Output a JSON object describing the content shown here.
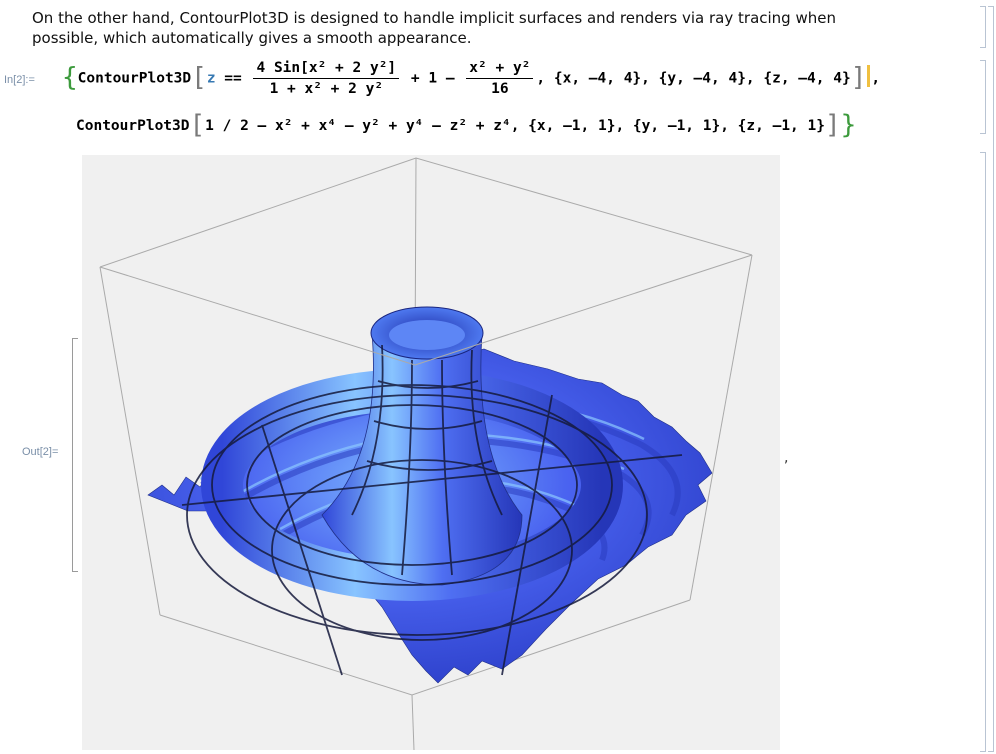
{
  "text_cell": {
    "line1": "On the other hand, ContourPlot3D is designed to handle implicit surfaces and renders via ray tracing when",
    "line2": "possible, which automatically gives a smooth appearance."
  },
  "input_cell": {
    "label": "In[2]:=",
    "line1": {
      "head": "ContourPlot3D",
      "var_z": "z",
      "eq": "==",
      "frac1_num": "4 Sin[x² + 2 y²]",
      "frac1_den": "1 + x² + 2 y²",
      "plus_one": "+ 1 –",
      "frac2_num": "x² + y²",
      "frac2_den": "16",
      "ranges": ", {x, –4, 4}, {y, –4, 4}, {z, –4, 4}",
      "close_comma": ","
    },
    "line2": {
      "head": "ContourPlot3D",
      "expr": "1 / 2 – x² + x⁴ – y² + y⁴ – z² + z⁴",
      "ranges": ", {x, –1, 1}, {y, –1, 1}, {z, –1, 1}"
    }
  },
  "output_cell": {
    "label": "Out[2]=",
    "trailing_comma": ","
  },
  "colors": {
    "surface_blue": "#4a63f0",
    "surface_highlight": "#7db8ff",
    "mesh": "#1a1a40",
    "box": "#b0b0b0",
    "panel_bg": "#f0f0f0"
  }
}
